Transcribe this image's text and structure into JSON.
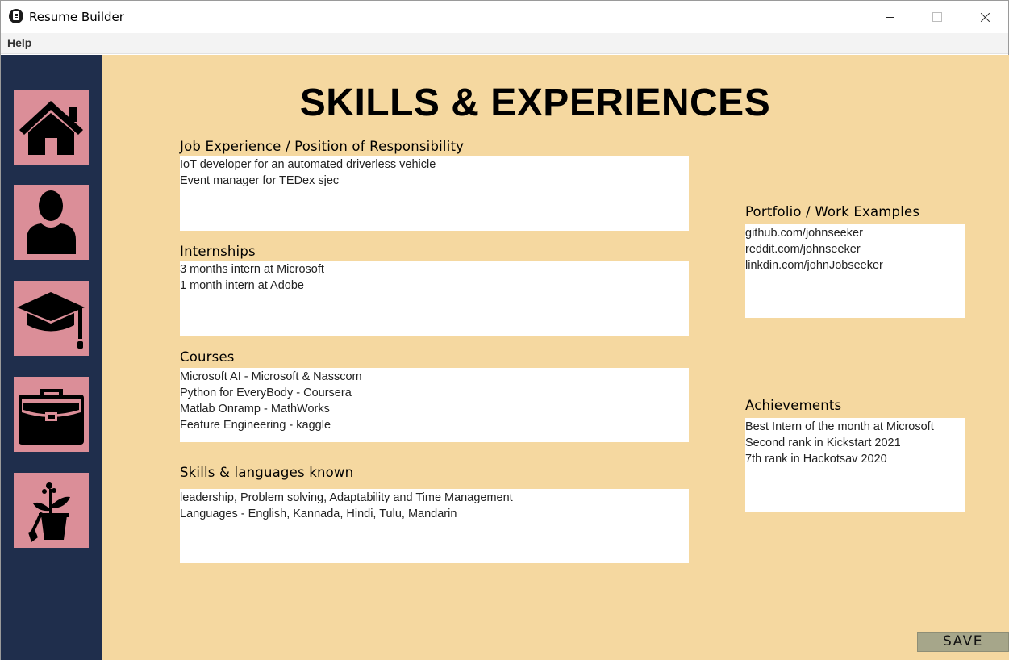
{
  "window": {
    "title": "Resume Builder"
  },
  "menu": {
    "help": "Help"
  },
  "sidebar": {
    "items": [
      {
        "icon": "home-icon"
      },
      {
        "icon": "person-icon"
      },
      {
        "icon": "graduation-cap-icon"
      },
      {
        "icon": "briefcase-icon"
      },
      {
        "icon": "plant-shovel-icon"
      }
    ]
  },
  "page": {
    "title": "SKILLS & EXPERIENCES"
  },
  "sections": {
    "job": {
      "label": "Job  Experience / Position of Responsibility",
      "lines": [
        "IoT developer for an automated driverless vehicle",
        "Event manager for TEDex sjec"
      ]
    },
    "internships": {
      "label": "Internships",
      "lines": [
        "3 months intern at Microsoft",
        "1 month intern at Adobe"
      ]
    },
    "courses": {
      "label": "Courses",
      "lines": [
        "Microsoft AI - Microsoft & Nasscom",
        "Python for EveryBody - Coursera",
        "Matlab Onramp - MathWorks",
        "Feature Engineering - kaggle"
      ]
    },
    "skills": {
      "label": "Skills & languages known",
      "lines": [
        "leadership, Problem solving, Adaptability and Time Management",
        "Languages - English, Kannada, Hindi, Tulu, Mandarin"
      ]
    },
    "portfolio": {
      "label": "Portfolio / Work Examples",
      "lines": [
        "github.com/johnseeker",
        "reddit.com/johnseeker",
        "linkdin.com/johnJobseeker"
      ]
    },
    "achievements": {
      "label": "Achievements",
      "lines": [
        "Best Intern of the month at Microsoft",
        "Second rank in Kickstart 2021",
        "7th rank in Hackotsav 2020"
      ]
    }
  },
  "actions": {
    "save": "SAVE"
  },
  "colors": {
    "sidebar_bg": "#1f2e4c",
    "nav_button_bg": "#db8e98",
    "main_bg": "#f5d8a0",
    "save_button_bg": "#a6a68a"
  }
}
